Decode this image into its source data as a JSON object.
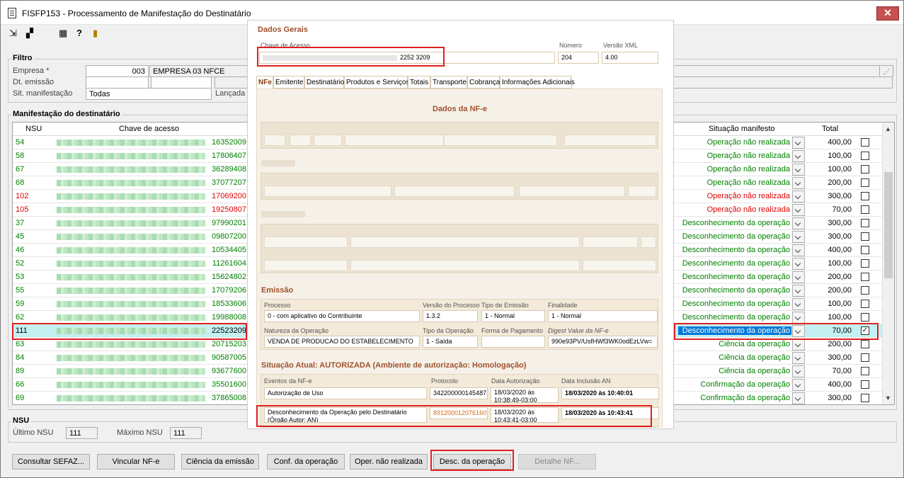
{
  "window": {
    "title": "FISFP153 - Processamento de Manifestação do Destinatário",
    "close": "✕"
  },
  "toolbar": {
    "icons": [
      "arrow-icon",
      "grid-icon",
      "calc-icon",
      "help-icon",
      "exit-icon"
    ]
  },
  "filter": {
    "title": "Filtro",
    "empresa_label": "Empresa *",
    "empresa_code": "003",
    "empresa_name": "EMPRESA 03 NFCE",
    "dt_emissao_label": "Dt. emissão",
    "sit_label": "Sit. manifestação",
    "sit_value": "Todas",
    "lancada_label": "Lançada"
  },
  "grid": {
    "title": "Manifestação do destinatário",
    "headers": {
      "nsu": "NSU",
      "chave": "Chave de acesso",
      "situacao": "Situação manifesto",
      "total": "Total"
    },
    "rows": [
      {
        "nsu": "54",
        "key": "16352009",
        "sit": "Operação não realizada",
        "total": "400,00",
        "color": "green",
        "checked": false
      },
      {
        "nsu": "58",
        "key": "17806407",
        "sit": "Operação não realizada",
        "total": "100,00",
        "color": "green",
        "checked": false
      },
      {
        "nsu": "67",
        "key": "36289408",
        "sit": "Operação não realizada",
        "total": "100,00",
        "color": "green",
        "checked": false
      },
      {
        "nsu": "68",
        "key": "37077207",
        "sit": "Operação não realizada",
        "total": "200,00",
        "color": "green",
        "checked": false
      },
      {
        "nsu": "102",
        "key": "17069200",
        "sit": "Operação não realizada",
        "total": "300,00",
        "color": "red",
        "checked": false
      },
      {
        "nsu": "105",
        "key": "19250807",
        "sit": "Operação não realizada",
        "total": "70,00",
        "color": "red",
        "checked": false
      },
      {
        "nsu": "37",
        "key": "97990201",
        "sit": "Desconhecimento da operação",
        "total": "300,00",
        "color": "green",
        "checked": false
      },
      {
        "nsu": "45",
        "key": "09807200",
        "sit": "Desconhecimento da operação",
        "total": "300,00",
        "color": "green",
        "checked": false
      },
      {
        "nsu": "46",
        "key": "10534405",
        "sit": "Desconhecimento da operação",
        "total": "400,00",
        "color": "green",
        "checked": false
      },
      {
        "nsu": "52",
        "key": "11261604",
        "sit": "Desconhecimento da operação",
        "total": "100,00",
        "color": "green",
        "checked": false
      },
      {
        "nsu": "53",
        "key": "15624802",
        "sit": "Desconhecimento da operação",
        "total": "200,00",
        "color": "green",
        "checked": false
      },
      {
        "nsu": "55",
        "key": "17079206",
        "sit": "Desconhecimento da operação",
        "total": "200,00",
        "color": "green",
        "checked": false
      },
      {
        "nsu": "59",
        "key": "18533606",
        "sit": "Desconhecimento da operação",
        "total": "100,00",
        "color": "green",
        "checked": false
      },
      {
        "nsu": "62",
        "key": "19988008",
        "sit": "Desconhecimento da operação",
        "total": "100,00",
        "color": "green",
        "checked": false
      },
      {
        "nsu": "111",
        "key": "22523209",
        "sit": "Desconhecimento da operação",
        "total": "70,00",
        "color": "green",
        "checked": true,
        "selected": true
      },
      {
        "nsu": "63",
        "key": "20715203",
        "sit": "Ciência da operação",
        "total": "200,00",
        "color": "green",
        "checked": false
      },
      {
        "nsu": "84",
        "key": "90587005",
        "sit": "Ciência da operação",
        "total": "300,00",
        "color": "green",
        "checked": false
      },
      {
        "nsu": "89",
        "key": "93677600",
        "sit": "Ciência da operação",
        "total": "70,00",
        "color": "green",
        "checked": false
      },
      {
        "nsu": "66",
        "key": "35501600",
        "sit": "Confirmação da operação",
        "total": "400,00",
        "color": "green",
        "checked": false
      },
      {
        "nsu": "69",
        "key": "37865008",
        "sit": "Confirmação da operação",
        "total": "300,00",
        "color": "green",
        "checked": false
      }
    ]
  },
  "nsu": {
    "title": "NSU",
    "ultimo_label": "Último NSU",
    "ultimo_value": "111",
    "maximo_label": "Máximo NSU",
    "maximo_value": "111"
  },
  "buttons": {
    "consultar": "Consultar SEFAZ...",
    "vincular": "Vincular NF-e",
    "ciencia": "Ciência da emissão",
    "conf": "Conf. da operação",
    "oper": "Oper. não realizada",
    "desc": "Desc. da operação",
    "detalhe": "Detalhe NF..."
  },
  "popup": {
    "dados_gerais": "Dados Gerais",
    "chave_label": "Chave de Acesso",
    "chave_value": "2252 3209",
    "numero_label": "Número",
    "numero_value": "204",
    "versao_label": "Versão XML",
    "versao_value": "4.00",
    "tabs": [
      "NFe",
      "Emitente",
      "Destinatário",
      "Produtos e Serviços",
      "Totais",
      "Transporte",
      "Cobrança",
      "Informações Adicionais"
    ],
    "dados_nfe": "Dados da NF-e",
    "emissao": {
      "title": "Emissão",
      "processo_label": "Processo",
      "processo_value": "0 - com aplicativo do Contribuinte",
      "versao_proc_label": "Versão do Processo",
      "versao_proc_value": "1.3.2",
      "tipo_emissao_label": "Tipo de Emissão",
      "tipo_emissao_value": "1 - Normal",
      "finalidade_label": "Finalidade",
      "finalidade_value": "1 - Normal",
      "natureza_label": "Natureza da Operação",
      "natureza_value": "VENDA DE PRODUCAO DO ESTABELECIMENTO",
      "tipo_op_label": "Tipo da Operação",
      "tipo_op_value": "1 - Saída",
      "forma_pag_label": "Forma de Pagamento",
      "digest_label": "Digest Value da NF-e",
      "digest_value": "990e93PV/UsfHWf3WK0odEzLVw="
    },
    "situacao": {
      "title": "Situação Atual: AUTORIZADA (Ambiente de autorização: Homologação)",
      "eventos_label": "Eventos da NF-e",
      "protocolo_label": "Protocolo",
      "data_aut_label": "Data Autorização",
      "data_inc_label": "Data Inclusão AN",
      "ev1_name": "Autorização de Uso",
      "ev1_prot": "342200000145487",
      "ev1_data": "18/03/2020 às 10:38:49-03:00",
      "ev1_inc": "18/03/2020 às 10:40:01",
      "ev2_name": "Desconhecimento da Operação pelo Destinatário (Órgão Autor: AN)",
      "ev2_prot": "891200012076160",
      "ev2_data": "18/03/2020 às 10:43:41-03:00",
      "ev2_inc": "18/03/2020 às 10:43:41"
    }
  }
}
